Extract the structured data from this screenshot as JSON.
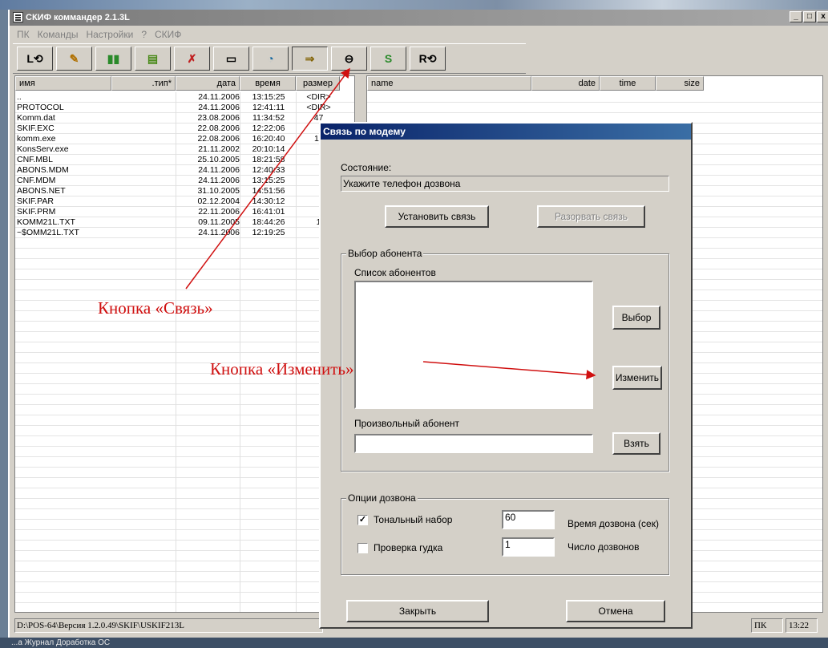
{
  "window": {
    "title": "СКИФ коммандер 2.1.3L",
    "min": "_",
    "max": "□",
    "close": "x"
  },
  "menu": [
    "ПК",
    "Команды",
    "Настройки",
    "?",
    "СКИФ"
  ],
  "toolbar": {
    "icons": [
      "drive-refresh-icon",
      "edit-icon",
      "copy-icon",
      "book-icon",
      "delete-icon",
      "folder-icon",
      "connect-icon",
      "modem-icon",
      "window-icon",
      "arrows-icon",
      "drive-r-refresh-icon"
    ],
    "glyphs": [
      "L⟲",
      "✎",
      "▮▮",
      "▤",
      "✗",
      "▭",
      "◔",
      "⇒",
      "⊖",
      "S",
      "R⟲"
    ]
  },
  "left_panel": {
    "headers": [
      "имя",
      ".тип*",
      "дата",
      "время",
      "размер"
    ],
    "files": [
      [
        "..",
        "",
        "24.11.2006",
        "13:15:25",
        "<DIR>"
      ],
      [
        "PROTOCOL",
        "",
        "24.11.2006",
        "12:41:11",
        "<DIR>"
      ],
      [
        "Komm.dat",
        "",
        "23.08.2006",
        "11:34:52",
        "47"
      ],
      [
        "SKIF.EXC",
        "",
        "22.08.2006",
        "12:22:06",
        ""
      ],
      [
        "komm.exe",
        "",
        "22.08.2006",
        "16:20:40",
        "11"
      ],
      [
        "KonsServ.exe",
        "",
        "21.11.2002",
        "20:10:14",
        ""
      ],
      [
        "CNF.MBL",
        "",
        "25.10.2005",
        "18:21:58",
        ""
      ],
      [
        "ABONS.MDM",
        "",
        "24.11.2006",
        "12:40:33",
        ""
      ],
      [
        "CNF.MDM",
        "",
        "24.11.2006",
        "13:15:25",
        ""
      ],
      [
        "ABONS.NET",
        "",
        "31.10.2005",
        "14:51:56",
        ""
      ],
      [
        "SKIF.PAR",
        "",
        "02.12.2004",
        "14:30:12",
        ""
      ],
      [
        "SKIF.PRM",
        "",
        "22.11.2006",
        "16:41:01",
        ""
      ],
      [
        "KOMM21L.TXT",
        "",
        "09.11.2005",
        "18:44:26",
        "1"
      ],
      [
        "~$OMM21L.TXT",
        "",
        "24.11.2006",
        "12:19:25",
        ""
      ]
    ]
  },
  "right_panel": {
    "headers": [
      "name",
      "date",
      "time",
      "size"
    ]
  },
  "status": {
    "path": "D:\\POS-64\\Версия 1.2.0.49\\SKIF\\USKIF213L",
    "pk": "ПК",
    "clock": "13:22"
  },
  "taskbar": {
    "text": "...а    Журнал    Доработка ОС"
  },
  "dialog": {
    "title": "Связь по модему",
    "state_label": "Состояние:",
    "state_value": "Укажите телефон дозвона",
    "connect": "Установить связь",
    "disconnect": "Разорвать связь",
    "subscriber_group": "Выбор абонента",
    "list_label": "Список абонентов",
    "choose": "Выбор",
    "change": "Изменить",
    "custom_label": "Произвольный абонент",
    "custom_value": "",
    "take": "Взять",
    "options_group": "Опции дозвона",
    "tone_label": "Тональный набор",
    "tone_checked": true,
    "tone_mark": "✓",
    "dial_time": "60",
    "dial_time_label": "Время дозвона (сек)",
    "beep_label": "Проверка гудка",
    "beep_checked": false,
    "dial_count": "1",
    "dial_count_label": "Число дозвонов",
    "close": "Закрыть",
    "cancel": "Отмена"
  },
  "annotations": {
    "connect_button": "Кнопка «Связь»",
    "change_button": "Кнопка «Изменить»",
    "color": "#d01010"
  }
}
